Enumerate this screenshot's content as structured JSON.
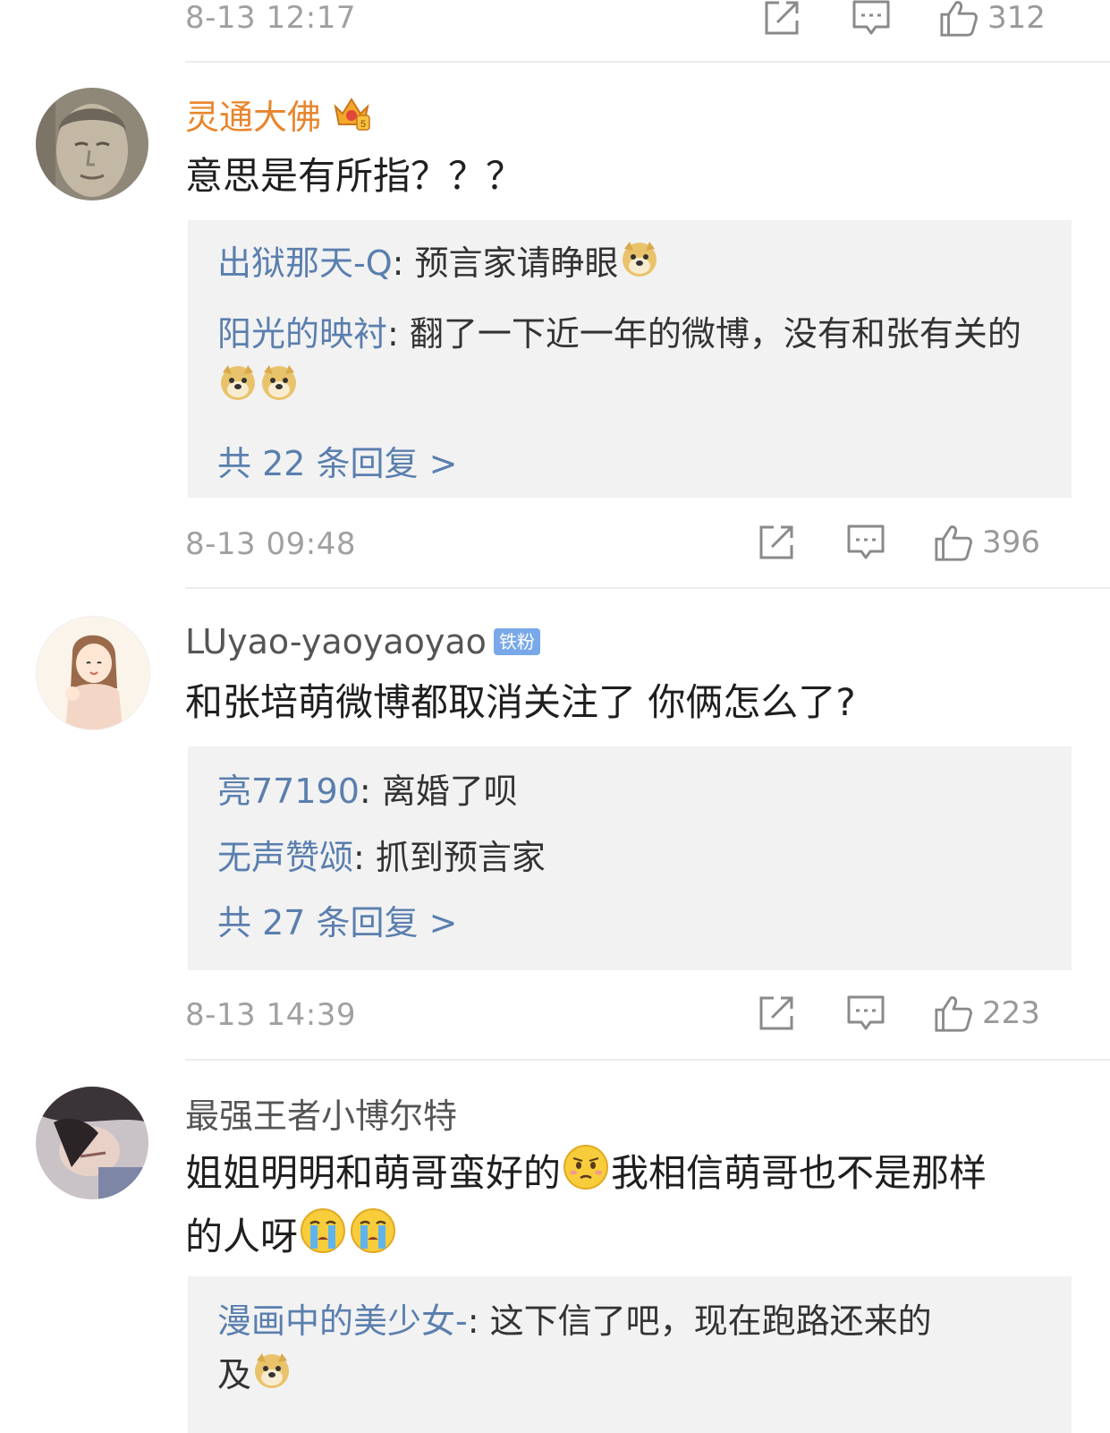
{
  "comments": [
    {
      "id": "c0",
      "time": "8-13 12:17",
      "likes": "312"
    },
    {
      "id": "c1",
      "user": "灵通大佛",
      "text": "意思是有所指？？？",
      "replies": [
        {
          "user": "出狱那天-Q",
          "text": "预言家请睁眼"
        },
        {
          "user": "阳光的映衬",
          "text": "翻了一下近一年的微博，没有和张有关的"
        }
      ],
      "more": "共 22 条回复 >",
      "time": "8-13 09:48",
      "likes": "396"
    },
    {
      "id": "c2",
      "user": "LUyao-yaoyaoyao",
      "badge": "铁粉",
      "text": "和张培萌微博都取消关注了 你俩怎么了?",
      "replies": [
        {
          "user": "亮77190",
          "text": "离婚了呗"
        },
        {
          "user": "无声赞颂",
          "text": "抓到预言家"
        }
      ],
      "more": "共 27 条回复 >",
      "time": "8-13 14:39",
      "likes": "223"
    },
    {
      "id": "c3",
      "user": "最强王者小博尔特",
      "text_a": "姐姐明明和萌哥蛮好的",
      "text_b": "我相信萌哥也不是那样",
      "text_c": "的人呀",
      "replies": [
        {
          "user": "漫画中的美少女-",
          "text_a": "这下信了吧，现在跑路还来的",
          "text_b": "及"
        }
      ]
    }
  ],
  "icons": {
    "share": "share-icon",
    "comment": "comment-icon",
    "like": "like-icon",
    "doge": "doge-emoji",
    "sad": "sad-emoji",
    "cry": "cry-emoji",
    "crown": "crown-badge-icon"
  },
  "colors": {
    "username_link": "#5a7fae",
    "vip_name": "#e8852c",
    "reply_bg": "#f2f2f2",
    "meta_gray": "#a0a0a0"
  }
}
